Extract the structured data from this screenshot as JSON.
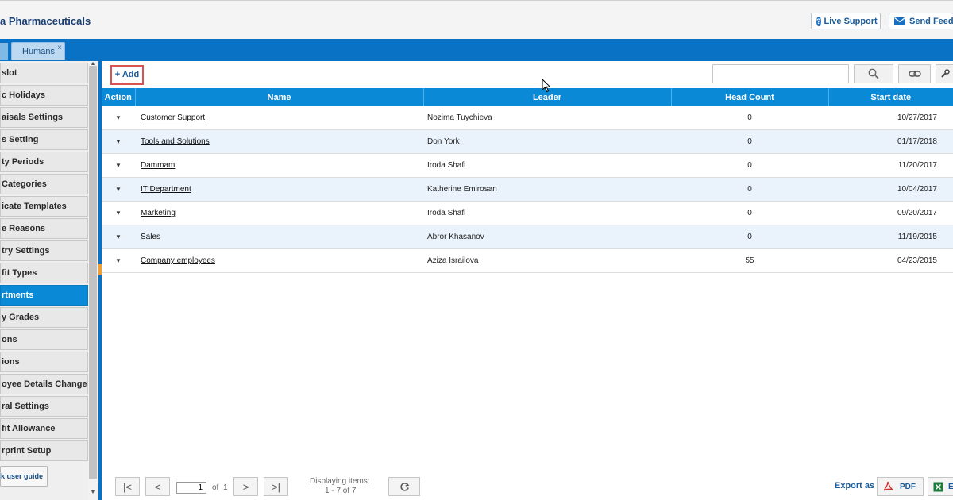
{
  "header": {
    "company_name": "a Pharmaceuticals",
    "live_support_label": "Live Support",
    "send_feedback_label": "Send Feedb"
  },
  "tabs": [
    {
      "label": "Humans",
      "close_glyph": "×"
    }
  ],
  "sidebar": {
    "items": [
      {
        "label": "slot"
      },
      {
        "label": "c Holidays"
      },
      {
        "label": "aisals Settings"
      },
      {
        "label": "s Setting"
      },
      {
        "label": "ty Periods"
      },
      {
        "label": "Categories"
      },
      {
        "label": "icate Templates"
      },
      {
        "label": "e Reasons"
      },
      {
        "label": "try Settings"
      },
      {
        "label": "fit Types"
      },
      {
        "label": "rtments"
      },
      {
        "label": "y Grades"
      },
      {
        "label": "ons"
      },
      {
        "label": "ions"
      },
      {
        "label": "oyee Details Changes"
      },
      {
        "label": "ral Settings"
      },
      {
        "label": "fit Allowance"
      },
      {
        "label": "rprint Setup"
      }
    ],
    "active_index": 10,
    "guide_label": "k user guide"
  },
  "toolbar": {
    "add_label": "+ Add",
    "search_value": ""
  },
  "grid": {
    "columns": [
      "Action",
      "Name",
      "Leader",
      "Head Count",
      "Start date"
    ],
    "rows": [
      {
        "name": "Customer Support",
        "leader": "Nozima Tuychieva",
        "head_count": "0",
        "start_date": "10/27/2017"
      },
      {
        "name": "Tools and Solutions",
        "leader": "Don York",
        "head_count": "0",
        "start_date": "01/17/2018"
      },
      {
        "name": "Dammam",
        "leader": "Iroda Shafi",
        "head_count": "0",
        "start_date": "11/20/2017"
      },
      {
        "name": "IT Department",
        "leader": "Katherine Emirosan",
        "head_count": "0",
        "start_date": "10/04/2017"
      },
      {
        "name": "Marketing",
        "leader": "Iroda Shafi",
        "head_count": "0",
        "start_date": "09/20/2017"
      },
      {
        "name": "Sales",
        "leader": "Abror Khasanov",
        "head_count": "0",
        "start_date": "11/19/2015"
      },
      {
        "name": "Company employees",
        "leader": "Aziza Israilova",
        "head_count": "55",
        "start_date": "04/23/2015"
      }
    ]
  },
  "pager": {
    "current_page": "1",
    "of_label": "of",
    "total_pages": "1",
    "displaying_label": "Displaying items:",
    "range_label": "1 - 7 of 7"
  },
  "export": {
    "label": "Export as",
    "pdf_label": "PDF",
    "excel_label": "E"
  }
}
